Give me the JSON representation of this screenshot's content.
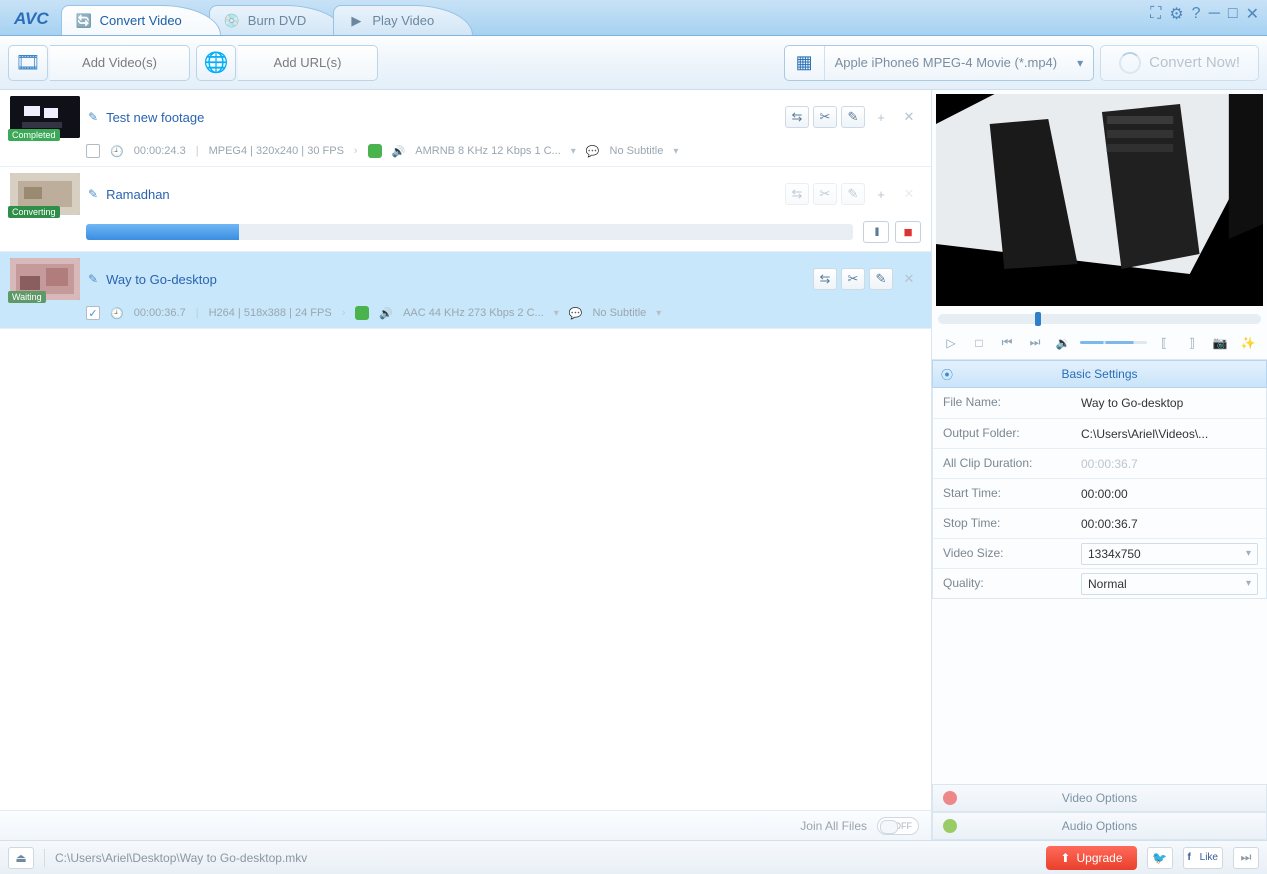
{
  "app": {
    "logo": "AVC"
  },
  "tabs": [
    {
      "label": "Convert Video",
      "active": true
    },
    {
      "label": "Burn DVD",
      "active": false
    },
    {
      "label": "Play Video",
      "active": false
    }
  ],
  "toolbar": {
    "add_videos": "Add Video(s)",
    "add_urls": "Add URL(s)",
    "profile": "Apple iPhone6 MPEG-4 Movie (*.mp4)",
    "convert": "Convert Now!"
  },
  "items": [
    {
      "title": "Test new footage",
      "status": "Completed",
      "status_class": "b-completed",
      "checked": false,
      "duration": "00:00:24.3",
      "vcodec": "MPEG4 | 320x240 | 30 FPS",
      "audio": "AMRNB 8 KHz 12 Kbps 1 C...",
      "subtitle": "No Subtitle",
      "progress": null,
      "selected": false,
      "close": true
    },
    {
      "title": "Ramadhan",
      "status": "Converting",
      "status_class": "b-converting",
      "checked": null,
      "duration": null,
      "vcodec": null,
      "audio": null,
      "subtitle": null,
      "progress": 20,
      "selected": false,
      "close": false
    },
    {
      "title": "Way to Go-desktop",
      "status": "Waiting",
      "status_class": "b-waiting",
      "checked": true,
      "duration": "00:00:36.7",
      "vcodec": "H264 | 518x388 | 24 FPS",
      "audio": "AAC 44 KHz 273 Kbps 2 C...",
      "subtitle": "No Subtitle",
      "progress": null,
      "selected": true,
      "close": false
    }
  ],
  "join_label": "Join All Files",
  "join_state": "OFF",
  "panels": {
    "basic_title": "Basic Settings",
    "rows": {
      "file_name_k": "File Name:",
      "file_name_v": "Way to Go-desktop",
      "out_folder_k": "Output Folder:",
      "out_folder_v": "C:\\Users\\Ariel\\Videos\\...",
      "clip_dur_k": "All Clip Duration:",
      "clip_dur_v": "00:00:36.7",
      "start_k": "Start Time:",
      "start_v": "00:00:00",
      "stop_k": "Stop Time:",
      "stop_v": "00:00:36.7",
      "vsize_k": "Video Size:",
      "vsize_v": "1334x750",
      "quality_k": "Quality:",
      "quality_v": "Normal"
    },
    "video_opts": "Video Options",
    "audio_opts": "Audio Options"
  },
  "footer": {
    "path": "C:\\Users\\Ariel\\Desktop\\Way to Go-desktop.mkv",
    "upgrade": "Upgrade",
    "like": "Like"
  }
}
